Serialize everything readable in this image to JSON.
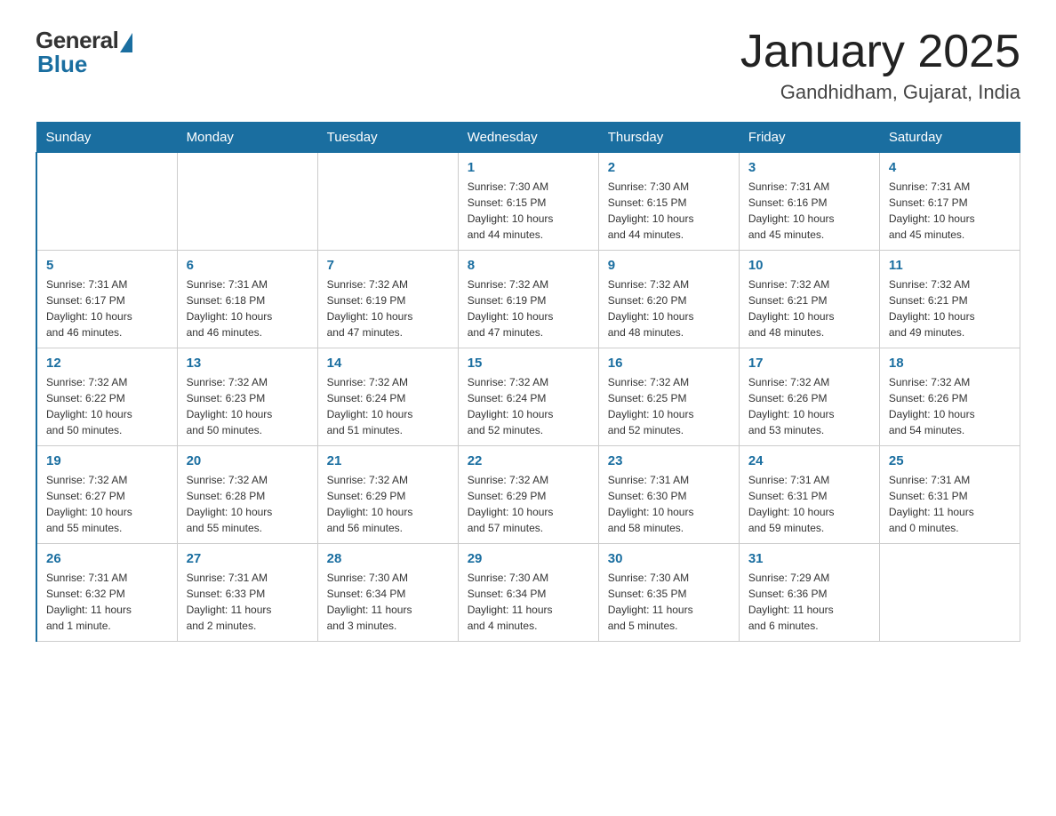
{
  "header": {
    "logo_general": "General",
    "logo_blue": "Blue",
    "month_title": "January 2025",
    "location": "Gandhidham, Gujarat, India"
  },
  "days_of_week": [
    "Sunday",
    "Monday",
    "Tuesday",
    "Wednesday",
    "Thursday",
    "Friday",
    "Saturday"
  ],
  "weeks": [
    [
      {
        "day": "",
        "info": ""
      },
      {
        "day": "",
        "info": ""
      },
      {
        "day": "",
        "info": ""
      },
      {
        "day": "1",
        "info": "Sunrise: 7:30 AM\nSunset: 6:15 PM\nDaylight: 10 hours\nand 44 minutes."
      },
      {
        "day": "2",
        "info": "Sunrise: 7:30 AM\nSunset: 6:15 PM\nDaylight: 10 hours\nand 44 minutes."
      },
      {
        "day": "3",
        "info": "Sunrise: 7:31 AM\nSunset: 6:16 PM\nDaylight: 10 hours\nand 45 minutes."
      },
      {
        "day": "4",
        "info": "Sunrise: 7:31 AM\nSunset: 6:17 PM\nDaylight: 10 hours\nand 45 minutes."
      }
    ],
    [
      {
        "day": "5",
        "info": "Sunrise: 7:31 AM\nSunset: 6:17 PM\nDaylight: 10 hours\nand 46 minutes."
      },
      {
        "day": "6",
        "info": "Sunrise: 7:31 AM\nSunset: 6:18 PM\nDaylight: 10 hours\nand 46 minutes."
      },
      {
        "day": "7",
        "info": "Sunrise: 7:32 AM\nSunset: 6:19 PM\nDaylight: 10 hours\nand 47 minutes."
      },
      {
        "day": "8",
        "info": "Sunrise: 7:32 AM\nSunset: 6:19 PM\nDaylight: 10 hours\nand 47 minutes."
      },
      {
        "day": "9",
        "info": "Sunrise: 7:32 AM\nSunset: 6:20 PM\nDaylight: 10 hours\nand 48 minutes."
      },
      {
        "day": "10",
        "info": "Sunrise: 7:32 AM\nSunset: 6:21 PM\nDaylight: 10 hours\nand 48 minutes."
      },
      {
        "day": "11",
        "info": "Sunrise: 7:32 AM\nSunset: 6:21 PM\nDaylight: 10 hours\nand 49 minutes."
      }
    ],
    [
      {
        "day": "12",
        "info": "Sunrise: 7:32 AM\nSunset: 6:22 PM\nDaylight: 10 hours\nand 50 minutes."
      },
      {
        "day": "13",
        "info": "Sunrise: 7:32 AM\nSunset: 6:23 PM\nDaylight: 10 hours\nand 50 minutes."
      },
      {
        "day": "14",
        "info": "Sunrise: 7:32 AM\nSunset: 6:24 PM\nDaylight: 10 hours\nand 51 minutes."
      },
      {
        "day": "15",
        "info": "Sunrise: 7:32 AM\nSunset: 6:24 PM\nDaylight: 10 hours\nand 52 minutes."
      },
      {
        "day": "16",
        "info": "Sunrise: 7:32 AM\nSunset: 6:25 PM\nDaylight: 10 hours\nand 52 minutes."
      },
      {
        "day": "17",
        "info": "Sunrise: 7:32 AM\nSunset: 6:26 PM\nDaylight: 10 hours\nand 53 minutes."
      },
      {
        "day": "18",
        "info": "Sunrise: 7:32 AM\nSunset: 6:26 PM\nDaylight: 10 hours\nand 54 minutes."
      }
    ],
    [
      {
        "day": "19",
        "info": "Sunrise: 7:32 AM\nSunset: 6:27 PM\nDaylight: 10 hours\nand 55 minutes."
      },
      {
        "day": "20",
        "info": "Sunrise: 7:32 AM\nSunset: 6:28 PM\nDaylight: 10 hours\nand 55 minutes."
      },
      {
        "day": "21",
        "info": "Sunrise: 7:32 AM\nSunset: 6:29 PM\nDaylight: 10 hours\nand 56 minutes."
      },
      {
        "day": "22",
        "info": "Sunrise: 7:32 AM\nSunset: 6:29 PM\nDaylight: 10 hours\nand 57 minutes."
      },
      {
        "day": "23",
        "info": "Sunrise: 7:31 AM\nSunset: 6:30 PM\nDaylight: 10 hours\nand 58 minutes."
      },
      {
        "day": "24",
        "info": "Sunrise: 7:31 AM\nSunset: 6:31 PM\nDaylight: 10 hours\nand 59 minutes."
      },
      {
        "day": "25",
        "info": "Sunrise: 7:31 AM\nSunset: 6:31 PM\nDaylight: 11 hours\nand 0 minutes."
      }
    ],
    [
      {
        "day": "26",
        "info": "Sunrise: 7:31 AM\nSunset: 6:32 PM\nDaylight: 11 hours\nand 1 minute."
      },
      {
        "day": "27",
        "info": "Sunrise: 7:31 AM\nSunset: 6:33 PM\nDaylight: 11 hours\nand 2 minutes."
      },
      {
        "day": "28",
        "info": "Sunrise: 7:30 AM\nSunset: 6:34 PM\nDaylight: 11 hours\nand 3 minutes."
      },
      {
        "day": "29",
        "info": "Sunrise: 7:30 AM\nSunset: 6:34 PM\nDaylight: 11 hours\nand 4 minutes."
      },
      {
        "day": "30",
        "info": "Sunrise: 7:30 AM\nSunset: 6:35 PM\nDaylight: 11 hours\nand 5 minutes."
      },
      {
        "day": "31",
        "info": "Sunrise: 7:29 AM\nSunset: 6:36 PM\nDaylight: 11 hours\nand 6 minutes."
      },
      {
        "day": "",
        "info": ""
      }
    ]
  ]
}
